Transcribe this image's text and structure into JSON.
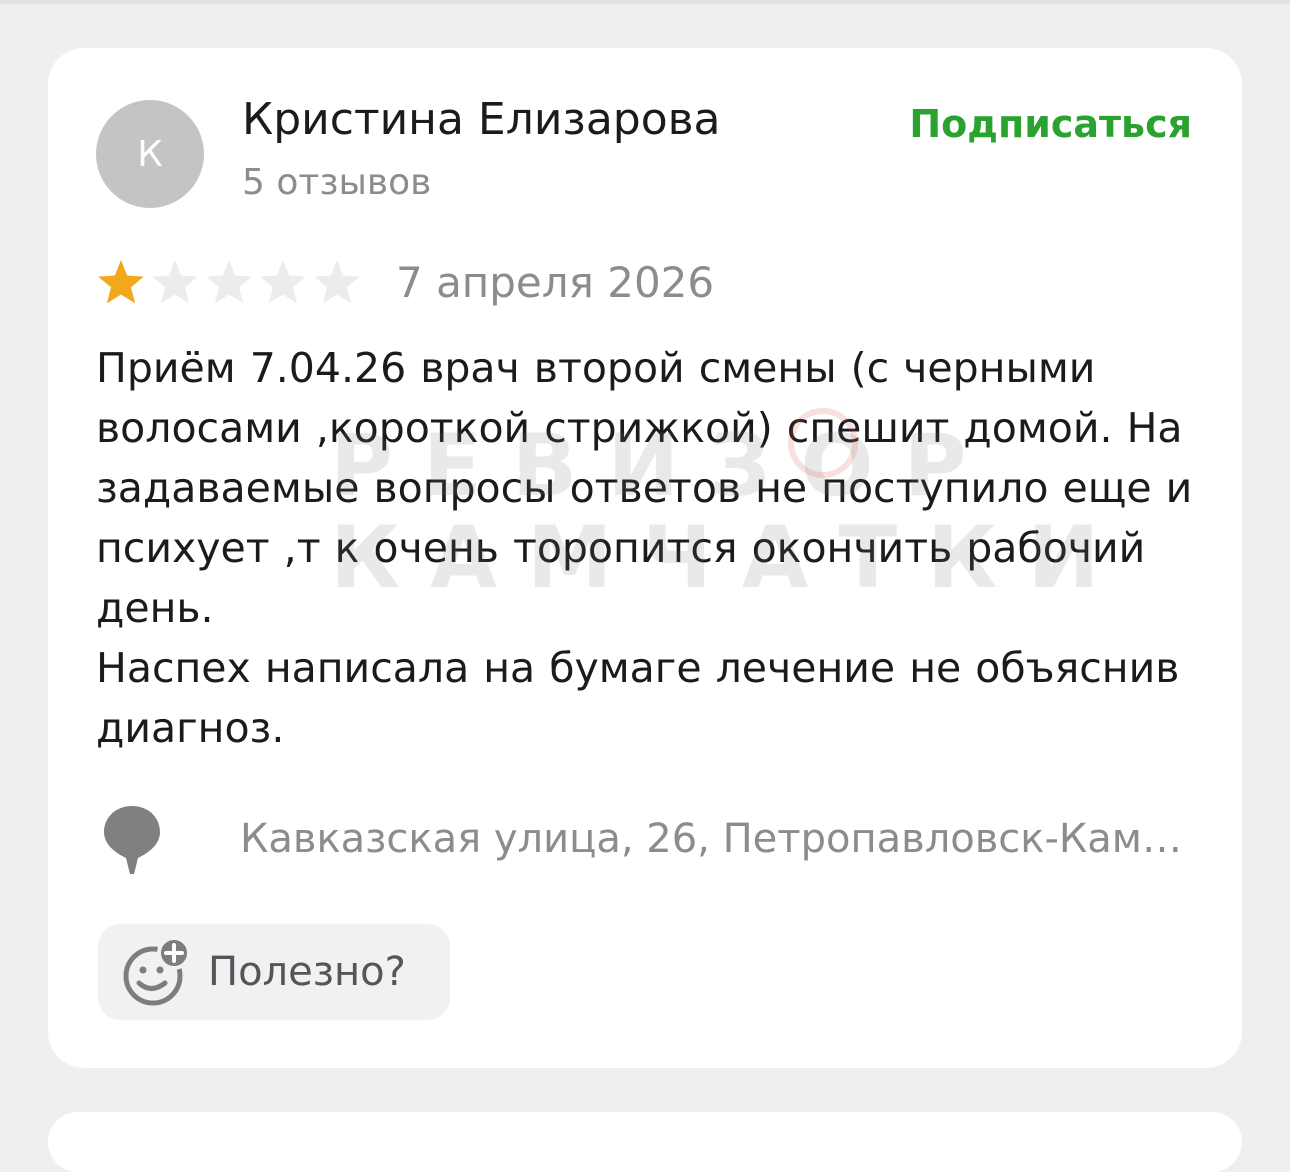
{
  "review": {
    "author": {
      "initial": "К",
      "name": "Кристина Елизарова",
      "reviews_count": "5 отзывов"
    },
    "subscribe_label": "Подписаться",
    "rating": {
      "value": 1,
      "max": 5
    },
    "date": "7 апреля 2026",
    "text": "Приём 7.04.26 врач второй смены (с черными\nволосами ,короткой стрижкой) спешит домой. На\nзадаваемые вопросы ответов не поступило еще и\nпсихует ,т к очень торопится окончить рабочий\nдень.\nНаспех написала на бумаге лечение не объяснив\nдиагноз.",
    "address": "Кавказская улица, 26, Петропавловск-Кам…",
    "useful_label": "Полезно?"
  },
  "watermark": {
    "line1": "РЕВИЗОР",
    "line2": "КАМЧАТКИ"
  },
  "icons": {
    "star": "star-icon",
    "pin": "map-pin-icon",
    "useful": "smile-plus-icon"
  },
  "colors": {
    "accent_green": "#2aa22f",
    "star_filled": "#f2a81c",
    "star_empty": "#ececee",
    "muted_text": "#8c8c90"
  }
}
